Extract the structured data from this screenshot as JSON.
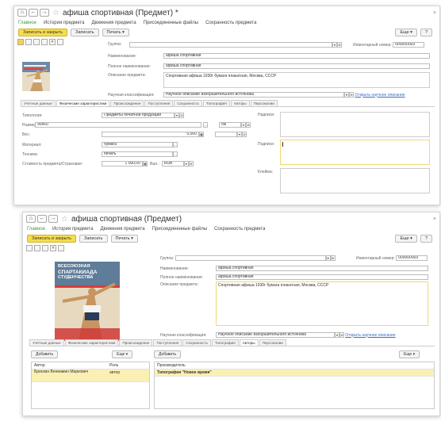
{
  "nav_glyphs": {
    "home": "⌂",
    "back": "←",
    "forward": "→",
    "star": "☆",
    "close": "×"
  },
  "win1": {
    "title": "афиша спортивная (Предмет) *",
    "nav": [
      "Главное",
      "История предмета",
      "Движения предмета",
      "Присоединенные файлы",
      "Сохранность предмета"
    ],
    "toolbar": {
      "save_close": "Записать и закрыть",
      "save": "Записать",
      "print": "Печать",
      "more": "Еще",
      "help": "?"
    },
    "header": {
      "group_label": "Группа:",
      "inventory_label": "Инвентарный номер:",
      "inventory_value": "000000003",
      "name_label": "Наименование:",
      "name_value": "афиша спортивная",
      "fullname_label": "Полное наименование:",
      "fullname_value": "афиша спортивная",
      "desc_label": "Описание предмета:",
      "desc_value": "Спортивная афиша 1930г бумага плакатная, Москва, СССР",
      "class_label": "Научная классификация:",
      "class_value": "Научное описание изобразительного источника",
      "open_link": "Открыть научное описание"
    },
    "tabs": [
      "Учётные данные",
      "Физические характеристики",
      "Происхождение",
      "Поступления",
      "Сохранность",
      "Топография",
      "Авторы",
      "Персоналии"
    ],
    "active_tab": 1,
    "phys": {
      "type_label": "Типология:",
      "type_value": "Предметы печатной продукции",
      "size_label": "Размеры:",
      "size_value": "90x60",
      "size_unit": "см",
      "weight_label": "Вес:",
      "weight_value": "0,000",
      "material_label": "Материал:",
      "material_value": "бумага",
      "tech_label": "Техника:",
      "tech_value": "печать",
      "cost_label": "Стоимость предмета/Страховая:",
      "cost_value": "1 000,00",
      "currency_label": "Вал.:",
      "currency_value": "RUB",
      "inscriptions_label": "Надписи:",
      "signatures_label": "Подписи:",
      "stamps_label": "Клейма:"
    }
  },
  "win2": {
    "title": "афиша спортивная (Предмет)",
    "nav": [
      "Главное",
      "История предмета",
      "Движения предмета",
      "Присоединенные файлы",
      "Сохранность предмета"
    ],
    "toolbar": {
      "save_close": "Записать и закрыть",
      "save": "Записать",
      "print": "Печать",
      "more": "Еще",
      "help": "?"
    },
    "header": {
      "group_label": "Группа:",
      "inventory_label": "Инвентарный номер:",
      "inventory_value": "000000003",
      "name_label": "Наименование:",
      "name_value": "афиша спортивная",
      "fullname_label": "Полное наименование:",
      "fullname_value": "афиша спортивная",
      "desc_label": "Описание предмета:",
      "desc_value": "Спортивная афиша 1930г бумага плакатная, Москва, СССР",
      "class_label": "Научная классификация:",
      "class_value": "Научное описание изобразительного источника",
      "open_link": "Открыть научное описание"
    },
    "poster_text": [
      "ВСЕСОЮЗНАЯ",
      "СПАРТАКИАДА",
      "СТУДЕНЧЕСТВА"
    ],
    "tabs": [
      "Учётные данные",
      "Физические характеристики",
      "Происхождение",
      "Поступления",
      "Сохранность",
      "Топография",
      "Авторы",
      "Персоналии"
    ],
    "active_tab": 6,
    "authors": {
      "add_label": "Добавить",
      "more_label": "Еще",
      "col_author": "Автор",
      "col_role": "Роль",
      "row_author": "Брискин Вениамин Маркович",
      "row_role": "автор",
      "col_producer": "Производитель",
      "row_producer": "Типография \"Новое время\""
    }
  }
}
